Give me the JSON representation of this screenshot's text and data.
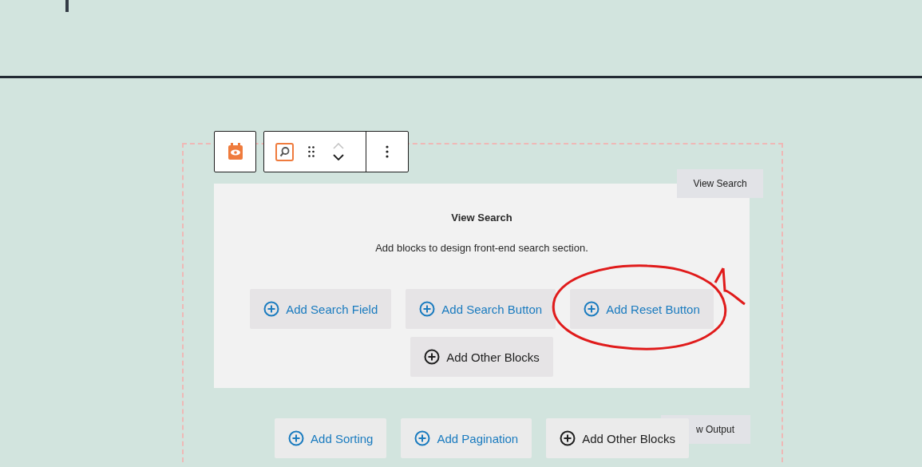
{
  "toolbar": {
    "move_up": {
      "disabled": true
    },
    "move_down": {
      "disabled": false
    }
  },
  "search_panel": {
    "tag": "View Search",
    "title": "View Search",
    "description": "Add blocks to design front-end search section.",
    "buttons": [
      {
        "label": "Add Search Field",
        "kind": "primary"
      },
      {
        "label": "Add Search Button",
        "kind": "primary"
      },
      {
        "label": "Add Reset Button",
        "kind": "primary"
      },
      {
        "label": "Add Other Blocks",
        "kind": "other"
      }
    ]
  },
  "output": {
    "tag": "w Output",
    "buttons": [
      {
        "label": "Add Sorting",
        "kind": "primary"
      },
      {
        "label": "Add Pagination",
        "kind": "primary"
      },
      {
        "label": "Add Other Blocks",
        "kind": "other"
      }
    ]
  }
}
